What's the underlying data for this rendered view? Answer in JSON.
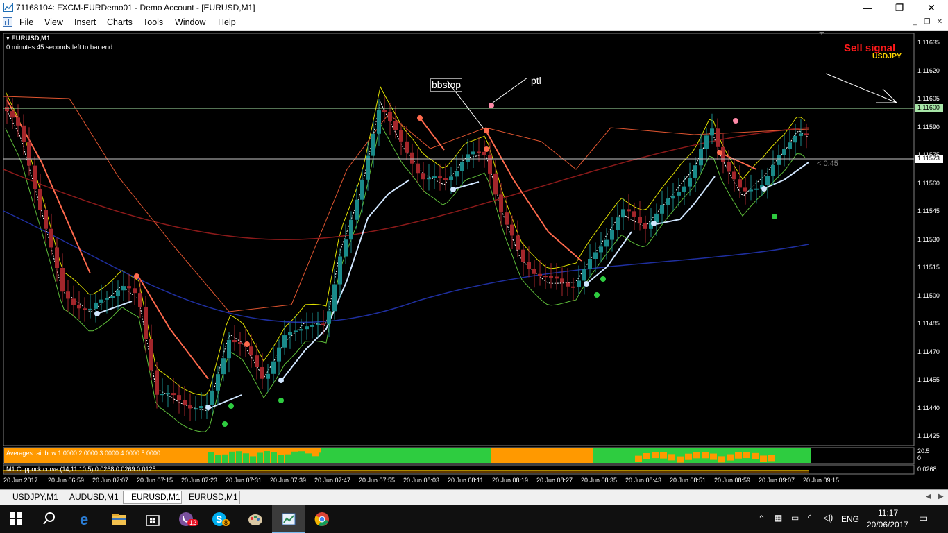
{
  "window": {
    "title": "71168104: FXCM-EURDemo01 - Demo Account - [EURUSD,M1]",
    "minimize": "—",
    "maximize": "❐",
    "close": "✕"
  },
  "menu": {
    "items": [
      "File",
      "View",
      "Insert",
      "Charts",
      "Tools",
      "Window",
      "Help"
    ]
  },
  "chart": {
    "symbol_label": "EURUSD,M1",
    "timer_label": "0 minutes 45 seconds left to bar end",
    "signal_title": "Sell signal",
    "signal_symbol": "USDJPY",
    "countdown": "< 0:45",
    "annotations": [
      "bbstop",
      "ptl"
    ],
    "price_labels": [
      "1.11635",
      "1.11620",
      "1.11605",
      "1.11590",
      "1.11575",
      "1.11560",
      "1.11545",
      "1.11530",
      "1.11515",
      "1.11500",
      "1.11485",
      "1.11470",
      "1.11455",
      "1.11440",
      "1.11425"
    ],
    "highlight_prices": [
      "1.11600",
      "1.11573"
    ],
    "time_labels": [
      "20 Jun 2017",
      "20 Jun 06:59",
      "20 Jun 07:07",
      "20 Jun 07:15",
      "20 Jun 07:23",
      "20 Jun 07:31",
      "20 Jun 07:39",
      "20 Jun 07:47",
      "20 Jun 07:55",
      "20 Jun 08:03",
      "20 Jun 08:11",
      "20 Jun 08:19",
      "20 Jun 08:27",
      "20 Jun 08:35",
      "20 Jun 08:43",
      "20 Jun 08:51",
      "20 Jun 08:59",
      "20 Jun 09:07",
      "20 Jun 09:15"
    ],
    "colors": {
      "bull": "#1a8a8a",
      "bear": "#a3262b",
      "horizontal_line": "#a8e6a8",
      "bid_line": "#c8c8c8"
    }
  },
  "indicators": {
    "rainbow_label": "Averages rainbow 1.0000 2.0000 3.0000 4.0000 5.0000",
    "rainbow_scale_top": "20.5",
    "rainbow_scale_bottom": "0",
    "coppock_label": "M1 Coppock curve (14,11,10,5) 0.0268 0.0269 0.0125",
    "coppock_scale": "0.0268"
  },
  "tabs": [
    {
      "label": "USDJPY,M1",
      "active": false
    },
    {
      "label": "AUDUSD,M1",
      "active": false
    },
    {
      "label": "EURUSD,M1",
      "active": true
    },
    {
      "label": "EURUSD,M1",
      "active": false
    }
  ],
  "taskbar": {
    "language": "ENG",
    "time": "11:17",
    "date": "20/06/2017",
    "badge_viber": "12",
    "badge_skype": "8"
  }
}
